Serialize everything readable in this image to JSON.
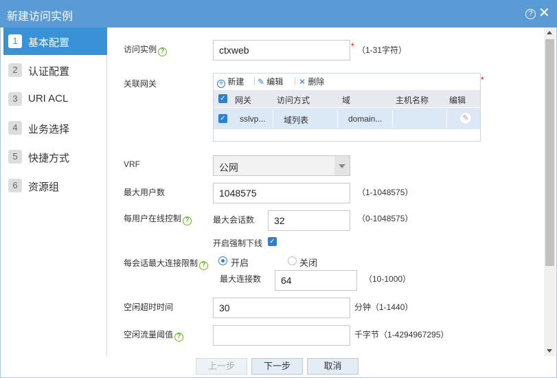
{
  "dialog": {
    "title": "新建访问实例",
    "help_glyph": "?",
    "close_glyph": "✕"
  },
  "steps": [
    {
      "num": "1",
      "label": "基本配置"
    },
    {
      "num": "2",
      "label": "认证配置"
    },
    {
      "num": "3",
      "label": "URI ACL"
    },
    {
      "num": "4",
      "label": "业务选择"
    },
    {
      "num": "5",
      "label": "快捷方式"
    },
    {
      "num": "6",
      "label": "资源组"
    }
  ],
  "form": {
    "instance": {
      "label": "访问实例",
      "value": "ctxweb",
      "hint": "（1-31字符）"
    },
    "gateway": {
      "label": "关联网关",
      "toolbar": {
        "new": "新建",
        "edit": "编辑",
        "delete": "删除"
      },
      "columns": [
        "网关",
        "访问方式",
        "域",
        "主机名称",
        "编辑"
      ],
      "row": {
        "gateway": "sslvp...",
        "method": "域列表",
        "domain": "domain...",
        "host": ""
      }
    },
    "vrf": {
      "label": "VRF",
      "value": "公网"
    },
    "max_users": {
      "label": "最大用户数",
      "value": "1048575",
      "hint": "（1-1048575）"
    },
    "per_user_online": {
      "label": "每用户在线控制",
      "sub_label": "最大会话数",
      "value": "32",
      "hint": "（0-1048575）",
      "force_label": "开启强制下线"
    },
    "per_session_conn": {
      "label": "每会话最大连接限制",
      "on_label": "开启",
      "off_label": "关闭",
      "sub_label": "最大连接数",
      "value": "64",
      "hint": "（10-1000）"
    },
    "idle_timeout": {
      "label": "空闲超时时间",
      "value": "30",
      "hint": "分钟（1-1440）"
    },
    "idle_traffic": {
      "label": "空闲流量阈值",
      "value": "",
      "hint": "千字节（1-4294967295）"
    }
  },
  "footer": {
    "prev": "上一步",
    "next": "下一步",
    "cancel": "取消"
  },
  "required_mark": "*",
  "checkmark": "✓"
}
